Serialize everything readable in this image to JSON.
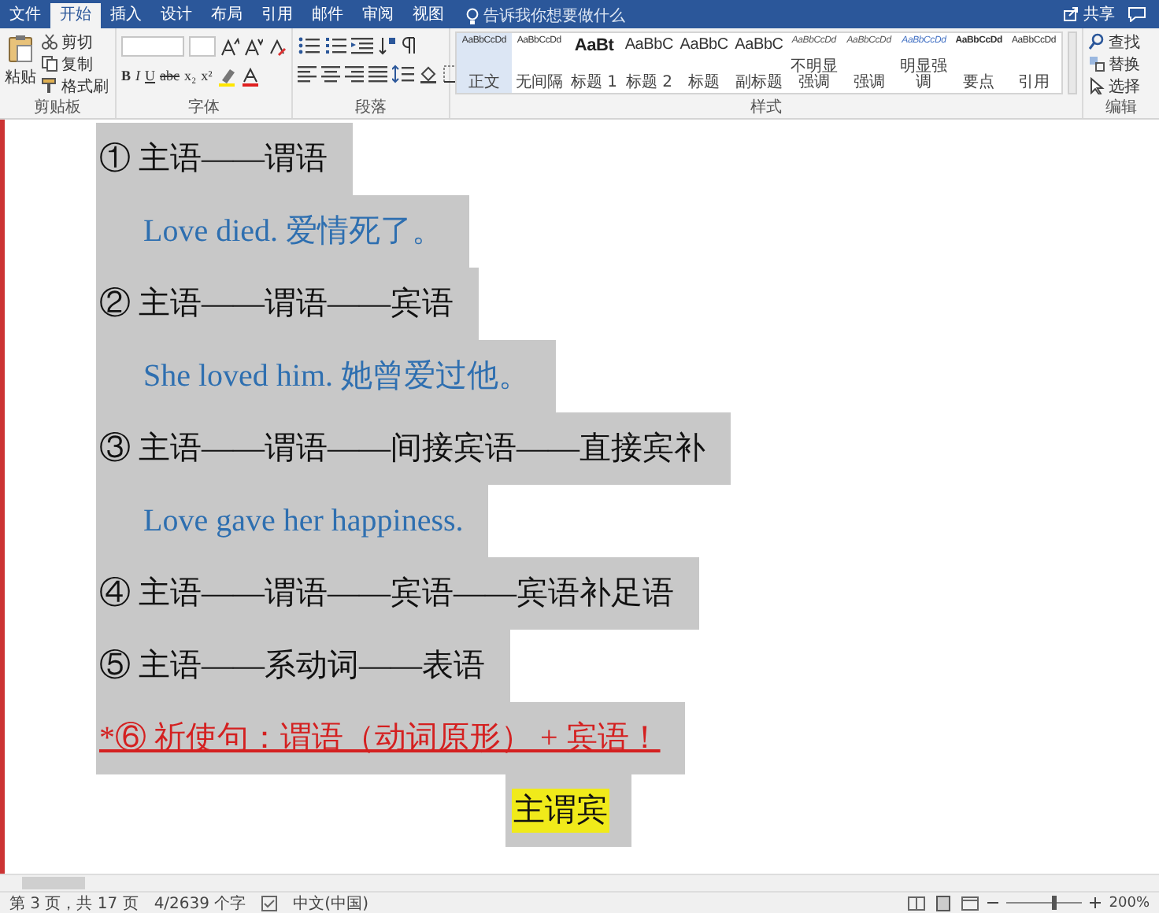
{
  "ribbon": {
    "tabs": [
      {
        "label": "文件",
        "selected": false
      },
      {
        "label": "开始",
        "selected": true
      },
      {
        "label": "插入",
        "selected": false
      },
      {
        "label": "设计",
        "selected": false
      },
      {
        "label": "布局",
        "selected": false
      },
      {
        "label": "引用",
        "selected": false
      },
      {
        "label": "邮件",
        "selected": false
      },
      {
        "label": "审阅",
        "selected": false
      },
      {
        "label": "视图",
        "selected": false
      }
    ],
    "tell_me": "告诉我你想要做什么",
    "share": "共享",
    "clipboard": {
      "paste": "粘贴",
      "cut": "剪切",
      "copy": "复制",
      "format_painter": "格式刷",
      "label": "剪贴板"
    },
    "font": {
      "buttons": [
        "B",
        "I",
        "U",
        "abc",
        "x₂",
        "x²"
      ],
      "label": "字体"
    },
    "paragraph": {
      "label": "段落"
    },
    "styles": {
      "items": [
        {
          "kind": "small",
          "preview": "AaBbCcDd",
          "name": "正文",
          "selected": true
        },
        {
          "kind": "small",
          "preview": "AaBbCcDd",
          "name": "无间隔",
          "selected": false
        },
        {
          "kind": "heading1",
          "preview": "AaBt",
          "name": "标题 1",
          "selected": false
        },
        {
          "kind": "heading",
          "preview": "AaBbC",
          "name": "标题 2",
          "selected": false
        },
        {
          "kind": "heading",
          "preview": "AaBbC",
          "name": "标题",
          "selected": false
        },
        {
          "kind": "heading",
          "preview": "AaBbC",
          "name": "副标题",
          "selected": false
        },
        {
          "kind": "italic",
          "preview": "AaBbCcDd",
          "name": "不明显强调",
          "selected": false
        },
        {
          "kind": "italic",
          "preview": "AaBbCcDd",
          "name": "强调",
          "selected": false
        },
        {
          "kind": "accent",
          "preview": "AaBbCcDd",
          "name": "明显强调",
          "selected": false
        },
        {
          "kind": "bold",
          "preview": "AaBbCcDd",
          "name": "要点",
          "selected": false
        },
        {
          "kind": "small",
          "preview": "AaBbCcDd",
          "name": "引用",
          "selected": false
        }
      ],
      "label": "样式"
    },
    "editing": {
      "find": "查找",
      "replace": "替换",
      "select": "选择",
      "label": "编辑"
    }
  },
  "document": {
    "paragraphs": [
      {
        "kind": "pattern",
        "shaded": true,
        "text": "① 主语——谓语"
      },
      {
        "kind": "example",
        "shaded": true,
        "text": "Love died. 爱情死了。"
      },
      {
        "kind": "pattern",
        "shaded": true,
        "text": "② 主语——谓语——宾语"
      },
      {
        "kind": "example",
        "shaded": true,
        "text": "She loved him. 她曾爱过他。"
      },
      {
        "kind": "pattern",
        "shaded": true,
        "text": "③ 主语——谓语——间接宾语——直接宾补"
      },
      {
        "kind": "example",
        "shaded": true,
        "text": "Love gave her happiness."
      },
      {
        "kind": "pattern",
        "shaded": true,
        "text": "④ 主语——谓语——宾语——宾语补足语"
      },
      {
        "kind": "pattern",
        "shaded": true,
        "text": "⑤ 主语——系动词——表语"
      },
      {
        "kind": "note",
        "shaded": true,
        "text": "*⑥ 祈使句：谓语（动词原形） + 宾语！"
      },
      {
        "kind": "highlight",
        "shaded": true,
        "text": "主谓宾"
      }
    ]
  },
  "status_bar": {
    "page": "第 3 页，共 17 页",
    "words": "4/2639 个字",
    "language": "中文(中国)",
    "zoom": "200%",
    "zoom_slider": {
      "level": 0.62
    }
  }
}
